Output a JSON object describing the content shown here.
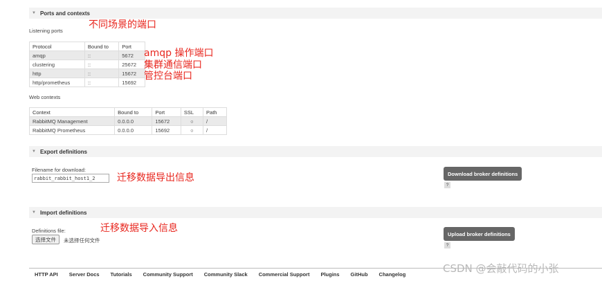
{
  "ports_section": {
    "title": "Ports and contexts",
    "listening_label": "Listening ports",
    "ports_table": {
      "headers": [
        "Protocol",
        "Bound to",
        "Port"
      ],
      "rows": [
        [
          "amqp",
          "::",
          "5672"
        ],
        [
          "clustering",
          "::",
          "25672"
        ],
        [
          "http",
          "::",
          "15672"
        ],
        [
          "http/prometheus",
          "::",
          "15692"
        ]
      ]
    },
    "web_label": "Web contexts",
    "web_table": {
      "headers": [
        "Context",
        "Bound to",
        "Port",
        "SSL",
        "Path"
      ],
      "rows": [
        [
          "RabbitMQ Management",
          "0.0.0.0",
          "15672",
          "○",
          "/"
        ],
        [
          "RabbitMQ Prometheus",
          "0.0.0.0",
          "15692",
          "○",
          "/"
        ]
      ]
    }
  },
  "export_section": {
    "title": "Export definitions",
    "filename_label": "Filename for download:",
    "filename_value": "rabbit_rabbit_host1_2",
    "button": "Download broker definitions",
    "help": "?"
  },
  "import_section": {
    "title": "Import definitions",
    "file_label": "Definitions file:",
    "choose_button": "选择文件",
    "no_file_text": "未选择任何文件",
    "button": "Upload broker definitions",
    "help": "?"
  },
  "annotations": {
    "scenario_ports": "不同场景的端口",
    "amqp": "amqp 操作端口",
    "cluster": "集群通信端口",
    "management": "管控台端口",
    "export": "迁移数据导出信息",
    "import": "迁移数据导入信息"
  },
  "footer": {
    "links": [
      "HTTP API",
      "Server Docs",
      "Tutorials",
      "Community Support",
      "Community Slack",
      "Commercial Support",
      "Plugins",
      "GitHub",
      "Changelog"
    ]
  },
  "watermark": "CSDN @会敲代码的小张",
  "icons": {
    "collapse": "triangle-down-icon"
  }
}
